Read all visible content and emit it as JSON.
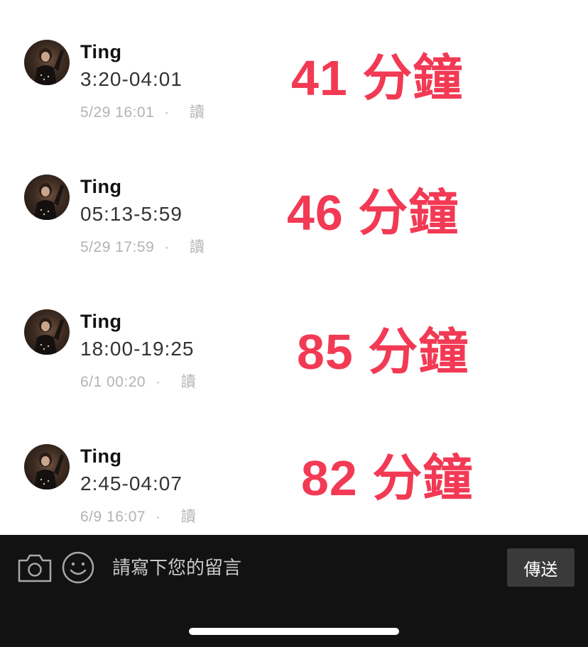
{
  "comments": [
    {
      "author": "Ting",
      "text": "3:20-04:01",
      "timestamp": "5/29 16:01",
      "separator": "·",
      "read_label": "讀",
      "annotation": "41 分鐘"
    },
    {
      "author": "Ting",
      "text": "05:13-5:59",
      "timestamp": "5/29 17:59",
      "separator": "·",
      "read_label": "讀",
      "annotation": "46 分鐘"
    },
    {
      "author": "Ting",
      "text": "18:00-19:25",
      "timestamp": "6/1 00:20",
      "separator": "·",
      "read_label": "讀",
      "annotation": "85 分鐘"
    },
    {
      "author": "Ting",
      "text": "2:45-04:07",
      "timestamp": "6/9 16:07",
      "separator": "·",
      "read_label": "讀",
      "annotation": "82 分鐘"
    }
  ],
  "composer": {
    "placeholder": "請寫下您的留言",
    "send_label": "傳送",
    "camera_icon": "camera-icon",
    "emoji_icon": "smile-icon"
  },
  "colors": {
    "annotation": "#f23a55",
    "bar_background": "#121212",
    "send_button": "#3a3a3a"
  }
}
